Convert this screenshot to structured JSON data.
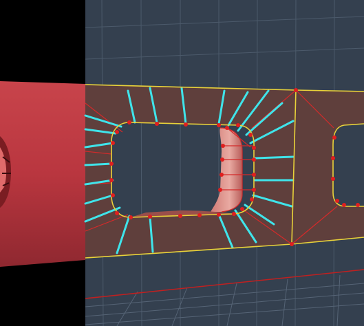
{
  "viewport": {
    "background_color": "#34404f",
    "left_panel_color": "#000000",
    "grid_color": "#4c5a6b",
    "floor_grid_color": "#566476"
  },
  "model": {
    "face_color": "#5f3f3c",
    "face_edge_color": "#e8d23a",
    "hole_inner_color": "#c46b67",
    "selected_edge_color": "#3fe4ea",
    "vertex_color": "#e01f1f",
    "wire_color": "#d42a2a",
    "preview_object_color": "#b9363f"
  },
  "axis": {
    "x_axis_color": "#c02020"
  }
}
